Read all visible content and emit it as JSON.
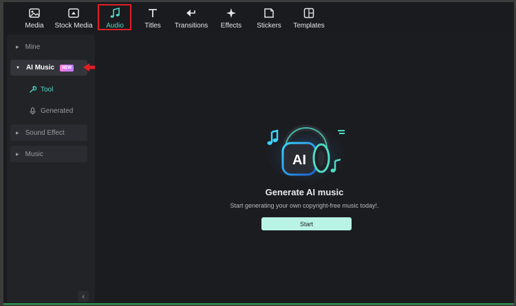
{
  "toolbar": {
    "tabs": [
      {
        "label": "Media",
        "icon": "image-icon"
      },
      {
        "label": "Stock Media",
        "icon": "stock-media-icon"
      },
      {
        "label": "Audio",
        "icon": "music-note-icon",
        "active": true
      },
      {
        "label": "Titles",
        "icon": "text-t-icon"
      },
      {
        "label": "Transitions",
        "icon": "transition-arrow-icon"
      },
      {
        "label": "Effects",
        "icon": "sparkle-icon"
      },
      {
        "label": "Stickers",
        "icon": "sticker-icon"
      },
      {
        "label": "Templates",
        "icon": "template-grid-icon"
      }
    ]
  },
  "sidebar": {
    "mine": "Mine",
    "ai_music": "AI Music",
    "ai_music_badge": "NEW",
    "tool": "Tool",
    "generated": "Generated",
    "sound_effect": "Sound Effect",
    "music": "Music",
    "collapse": "‹"
  },
  "main": {
    "hero_text": "AI",
    "title": "Generate AI music",
    "subtitle": "Start generating your own copyright-free music today!.",
    "start_button": "Start"
  },
  "colors": {
    "accent": "#4fdcc6",
    "highlight": "#e01f26",
    "button_bg": "#b9f3e6"
  }
}
